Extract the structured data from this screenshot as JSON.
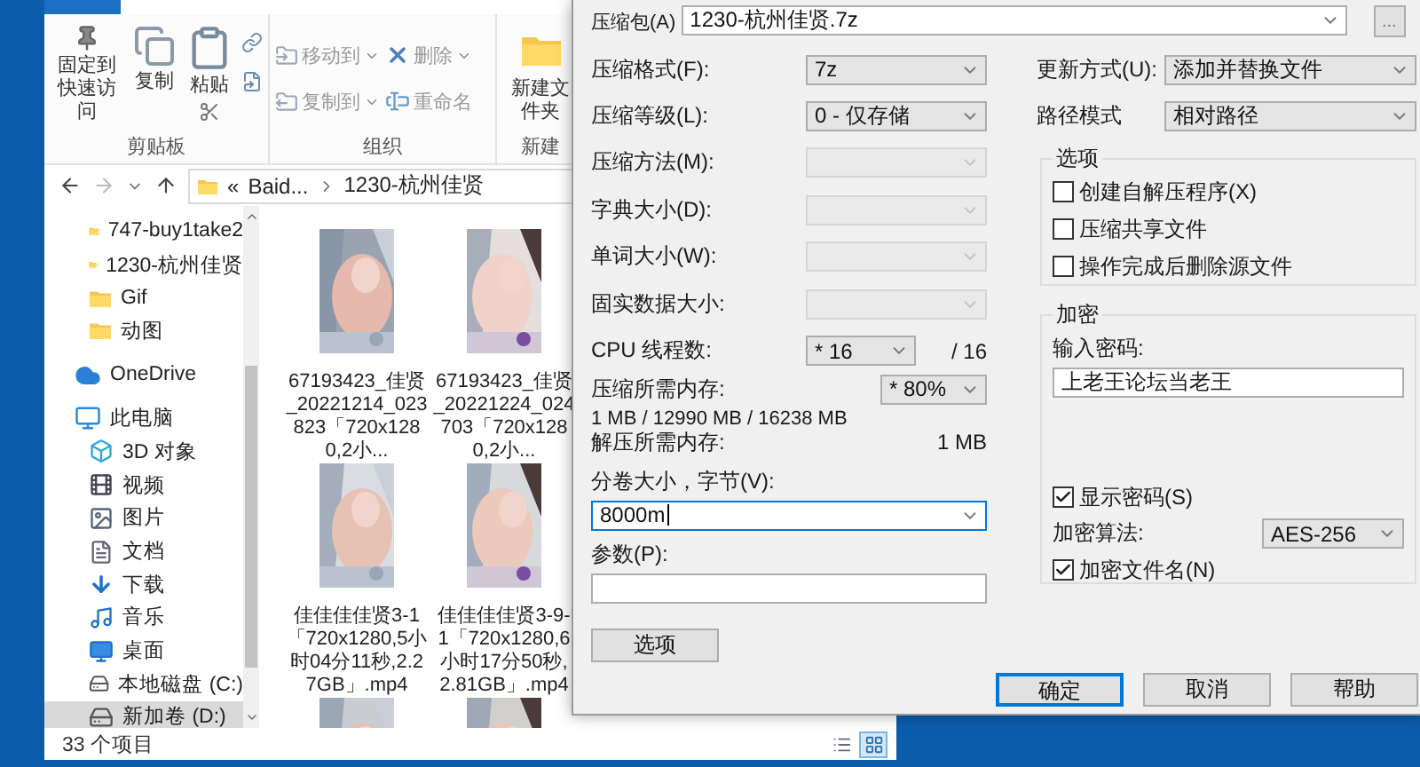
{
  "explorer": {
    "ribbon": [
      {
        "label": "剪贴板",
        "kind": "clipboard",
        "commands": [
          {
            "label": "固定到快速访问"
          },
          {
            "label": "复制"
          },
          {
            "label": "粘贴"
          }
        ]
      },
      {
        "label": "组织",
        "kind": "pairs",
        "commands": [
          {
            "label": "移动到",
            "dropdown": true,
            "disabled": true
          },
          {
            "label": "复制到",
            "dropdown": true,
            "disabled": true
          },
          {
            "label": "删除",
            "dropdown": true,
            "disabled": true
          },
          {
            "label": "重命名",
            "dropdown": false,
            "disabled": true
          }
        ]
      },
      {
        "label": "新建",
        "kind": "large",
        "commands": [
          {
            "label": "新建文件夹"
          }
        ]
      }
    ],
    "address": {
      "overflow": "«",
      "crumbs": [
        "Baid...",
        "1230-杭州佳贤"
      ]
    },
    "nav": {
      "scrolled_children": [
        {
          "label": "747-buy1take2",
          "selected": false
        },
        {
          "label": "1230-杭州佳贤",
          "selected": false
        },
        {
          "label": "Gif",
          "selected": false
        },
        {
          "label": "动图",
          "selected": false
        }
      ],
      "items": [
        {
          "label": "OneDrive",
          "selected": false
        },
        {
          "label": "此电脑",
          "selected": false,
          "children": [
            {
              "label": "3D 对象",
              "selected": false
            },
            {
              "label": "视频",
              "selected": false
            },
            {
              "label": "图片",
              "selected": false
            },
            {
              "label": "文档",
              "selected": false
            },
            {
              "label": "下载",
              "selected": false
            },
            {
              "label": "音乐",
              "selected": false
            },
            {
              "label": "桌面",
              "selected": false
            },
            {
              "label": "本地磁盘 (C:)",
              "selected": false
            },
            {
              "label": "新加卷 (D:)",
              "selected": true
            }
          ]
        }
      ]
    },
    "files": [
      {
        "kind": "picture",
        "caption": "67193423_佳贤_20221214_023823「720x1280,2小..."
      },
      {
        "kind": "picture",
        "caption": "67193423_佳贤_20221224_024703「720x1280,2小..."
      },
      {
        "kind": "picture",
        "caption": "佳佳佳佳贤3-1「720x1280,5小时04分11秒,2.27GB」.mp4"
      },
      {
        "kind": "picture",
        "caption": "佳佳佳佳贤3-9-1「720x1280,6小时17分50秒,2.81GB」.mp4"
      },
      {
        "kind": "picture"
      },
      {
        "kind": "picture"
      }
    ],
    "status": {
      "count": "33 个项目",
      "views": [
        {
          "kind": "details",
          "selected": false
        },
        {
          "kind": "thumbnails",
          "selected": true
        }
      ]
    }
  },
  "dialog": {
    "archive": {
      "label": "压缩包(A)",
      "value": "1230-杭州佳贤.7z",
      "browse": "..."
    },
    "left_fields": [
      {
        "kind": "combo",
        "label": "压缩格式(F):",
        "value": "7z",
        "disabled": false
      },
      {
        "kind": "combo",
        "label": "压缩等级(L):",
        "value": "0 - 仅存储",
        "disabled": false
      },
      {
        "kind": "combo",
        "label": "压缩方法(M):",
        "disabled": true
      },
      {
        "kind": "combo",
        "label": "字典大小(D):",
        "disabled": true
      },
      {
        "kind": "combo",
        "label": "单词大小(W):",
        "disabled": true
      },
      {
        "kind": "combo",
        "label": "固实数据大小:",
        "disabled": true
      },
      {
        "kind": "threads",
        "label": "CPU 线程数:",
        "value": "* 16",
        "suffix": "/ 16",
        "disabled": false
      }
    ],
    "memory": {
      "label": "压缩所需内存:",
      "detail": "1 MB / 12990 MB / 16238 MB",
      "value": "* 80%"
    },
    "decompress": {
      "label": "解压所需内存:",
      "value": "1 MB"
    },
    "volume": {
      "label": "分卷大小，字节(V):",
      "value": "8000m",
      "focused": true
    },
    "params": {
      "label": "参数(P):"
    },
    "options_button": "选项",
    "update_mode": {
      "label": "更新方式(U):",
      "value": "添加并替换文件"
    },
    "path_mode": {
      "label": "路径模式",
      "value": "相对路径"
    },
    "options_group": {
      "title": "选项",
      "checkboxes": [
        {
          "label": "创建自解压程序(X)",
          "checked": false
        },
        {
          "label": "压缩共享文件",
          "checked": false
        },
        {
          "label": "操作完成后删除源文件",
          "checked": false
        }
      ]
    },
    "encryption": {
      "title": "加密",
      "password_label": "输入密码:",
      "password": "上老王论坛当老王",
      "show_password": {
        "label": "显示密码(S)",
        "checked": true
      },
      "method": {
        "label": "加密算法:",
        "value": "AES-256"
      },
      "encrypt_names": {
        "label": "加密文件名(N)",
        "checked": true
      }
    },
    "buttons": [
      {
        "label": "确定",
        "default": true
      },
      {
        "label": "取消",
        "default": false
      },
      {
        "label": "帮助",
        "default": false
      }
    ]
  }
}
